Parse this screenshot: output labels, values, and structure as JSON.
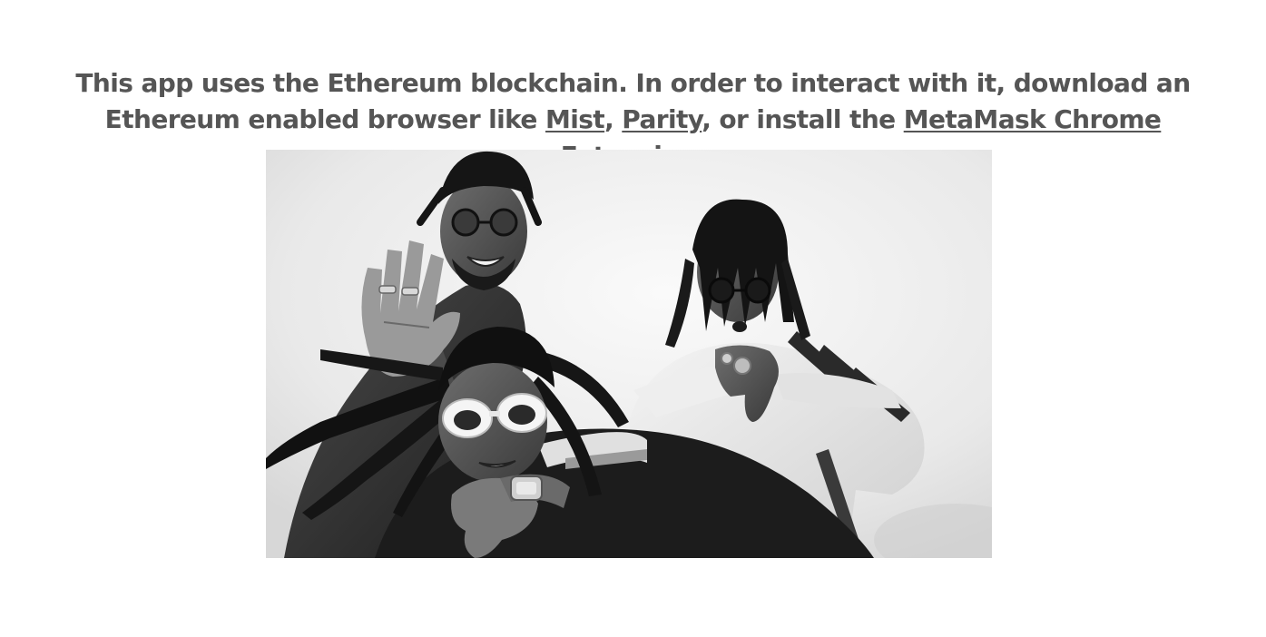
{
  "notice": {
    "before_links": "This app uses the Ethereum blockchain. In order to interact with it, download an Ethereum enabled browser like ",
    "link_mist": "Mist",
    "sep_1": ", ",
    "link_parity": "Parity",
    "sep_2": ", or install the ",
    "link_metamask": "MetaMask Chrome Extension",
    "end": "."
  }
}
